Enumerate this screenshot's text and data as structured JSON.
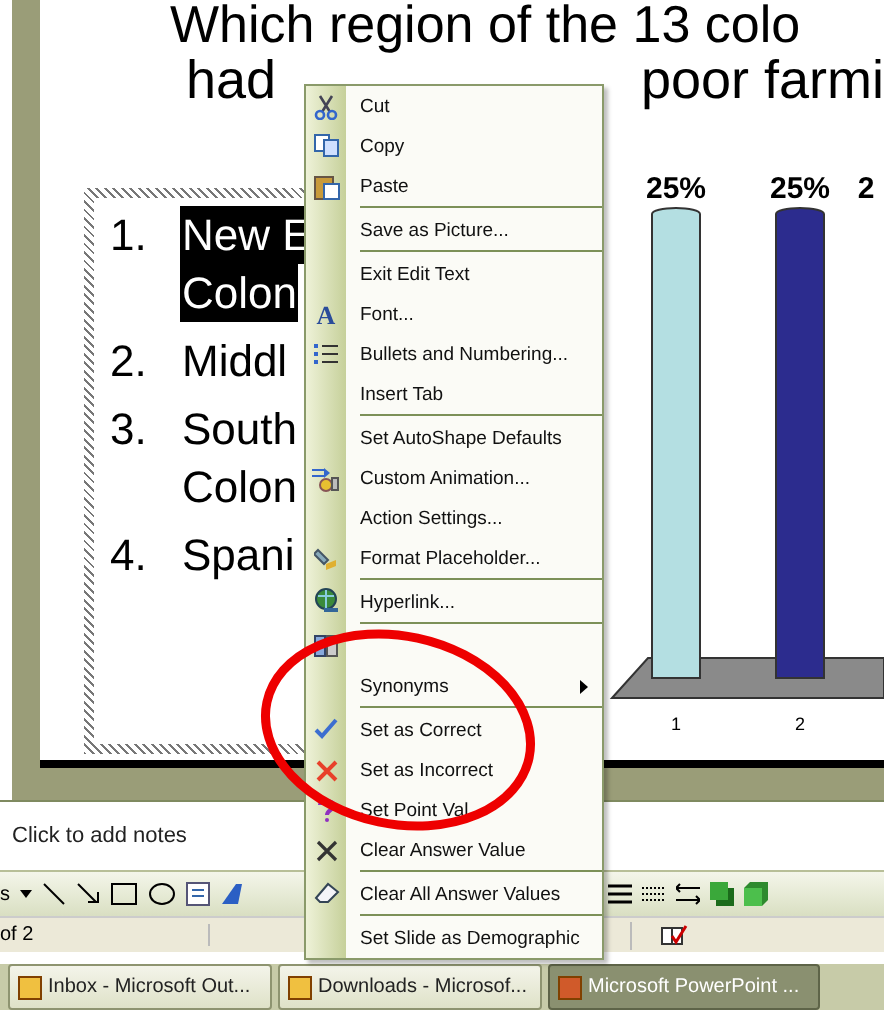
{
  "slide": {
    "title_line_1": "Which region of the 13 colo",
    "title_line_2": [
      "had",
      "poor farmi"
    ],
    "list": [
      {
        "number": "1.",
        "lines": [
          "New E",
          "Colon"
        ],
        "selected": true
      },
      {
        "number": "2.",
        "lines": [
          "Middl"
        ],
        "selected": false
      },
      {
        "number": "3.",
        "lines": [
          "South",
          "Colon"
        ],
        "selected": false
      },
      {
        "number": "4.",
        "lines": [
          "Spani"
        ],
        "selected": false
      }
    ],
    "chart": {
      "chart_data": {
        "type": "bar",
        "categories": [
          "1",
          "2"
        ],
        "values": [
          25,
          25
        ],
        "value_labels": [
          "25%",
          "25%"
        ]
      },
      "edge_label": "2"
    }
  },
  "context_menu": [
    {
      "label": "Cut",
      "separator_before": false,
      "submenu": false
    },
    {
      "label": "Copy",
      "separator_before": false,
      "submenu": false
    },
    {
      "label": "Paste",
      "separator_before": false,
      "submenu": false
    },
    {
      "label": "Save as Picture...",
      "separator_before": true,
      "submenu": false
    },
    {
      "label": "Exit Edit Text",
      "separator_before": true,
      "submenu": false
    },
    {
      "label": "Font...",
      "icon_text": "A",
      "separator_before": false,
      "submenu": false
    },
    {
      "label": "Bullets and Numbering...",
      "separator_before": false,
      "submenu": false
    },
    {
      "label": "Insert Tab",
      "separator_before": false,
      "submenu": false
    },
    {
      "label": "Set AutoShape Defaults",
      "separator_before": true,
      "submenu": false
    },
    {
      "label": "Custom Animation...",
      "separator_before": false,
      "submenu": false
    },
    {
      "label": "Action Settings...",
      "separator_before": false,
      "submenu": false
    },
    {
      "label": "Format Placeholder...",
      "separator_before": false,
      "submenu": false
    },
    {
      "label": "Hyperlink...",
      "separator_before": true,
      "submenu": false
    },
    {
      "separator_before": true,
      "submenu": false
    },
    {
      "label": "Synonyms",
      "separator_before": false,
      "submenu": true
    },
    {
      "label": "Set as Correct",
      "separator_before": true,
      "submenu": false
    },
    {
      "label": "Set as Incorrect",
      "separator_before": false,
      "submenu": false
    },
    {
      "label": "Set Point Val",
      "separator_before": false,
      "submenu": false
    },
    {
      "label": "Clear Answer Value",
      "separator_before": false,
      "submenu": false
    },
    {
      "label": "Clear All Answer Values",
      "separator_before": true,
      "submenu": false
    },
    {
      "label": "Set Slide as Demographic",
      "separator_before": true,
      "submenu": false
    }
  ],
  "notes": {
    "placeholder": "Click to add notes"
  },
  "drawing_toolbar": {
    "menu_label": "s"
  },
  "status_bar": {
    "slide_count": "of 2"
  },
  "taskbar": [
    {
      "label": "Inbox - Microsoft Out...",
      "selected": false
    },
    {
      "label": "Downloads - Microsof...",
      "selected": false
    },
    {
      "label": "Microsoft PowerPoint ...",
      "selected": true
    }
  ]
}
